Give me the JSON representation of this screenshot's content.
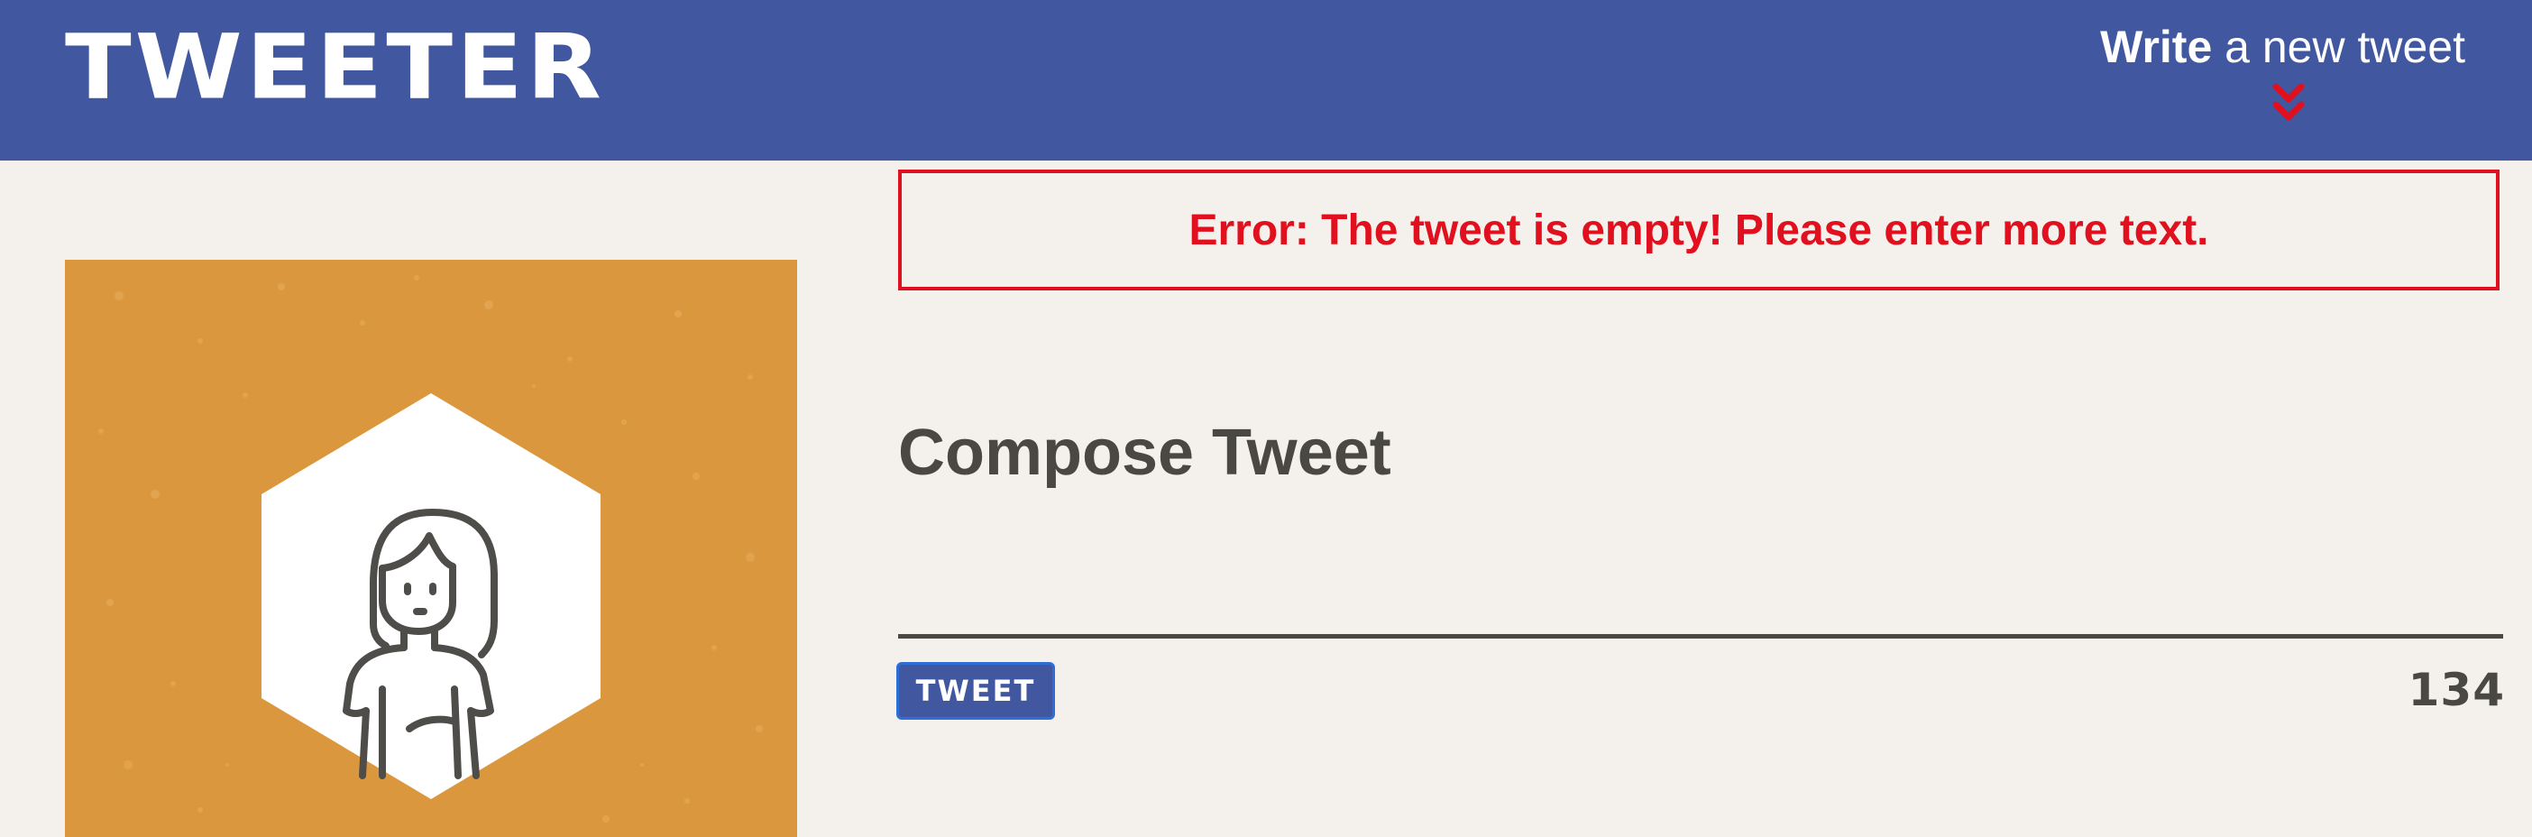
{
  "header": {
    "brand": "TWEETER",
    "write_link": {
      "strong": "Write",
      "rest": " a new tweet"
    },
    "chevron_icon": "double-chevron-down-icon"
  },
  "error": {
    "message": "Error: The tweet is empty! Please enter more text."
  },
  "profile": {
    "avatar_icon": "user-avatar-icon"
  },
  "compose": {
    "title": "Compose Tweet",
    "input_value": "",
    "button_label": "TWEET",
    "char_counter": "134"
  },
  "colors": {
    "header_bg": "#4158a1",
    "page_bg": "#f4f1ed",
    "error": "#e0101e",
    "avatar_bg": "#db973e",
    "text": "#4a4845"
  }
}
